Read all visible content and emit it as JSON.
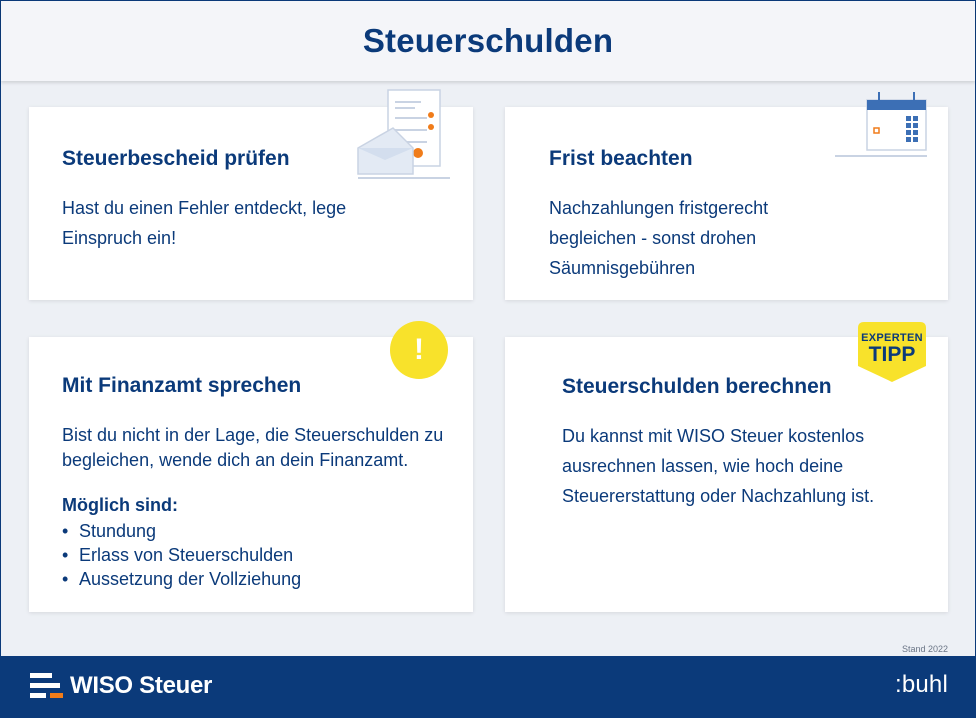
{
  "header": {
    "title": "Steuerschulden"
  },
  "cards": [
    {
      "title": "Steuerbescheid prüfen",
      "text": "Hast du einen Fehler entdeckt, lege Einspruch ein!",
      "icon": "document-envelope-icon"
    },
    {
      "title": "Frist beachten",
      "text": "Nachzahlungen fristgerecht begleichen - sonst drohen Säumnisgebühren",
      "icon": "calendar-icon"
    },
    {
      "title": "Mit Finanzamt sprechen",
      "text": "Bist du nicht in der Lage, die Steuerschulden zu begleichen, wende dich an dein Finanzamt.",
      "subheading": "Möglich sind:",
      "items": [
        "Stundung",
        "Erlass von Steuerschulden",
        "Aussetzung der Vollziehung"
      ],
      "icon": "exclamation-icon",
      "icon_symbol": "!"
    },
    {
      "title": "Steuerschulden berechnen",
      "text": "Du kannst mit WISO Steuer kostenlos ausrechnen lassen, wie hoch deine Steuererstattung oder Nachzahlung ist.",
      "badge": {
        "line1": "EXPERTEN",
        "line2": "TIPP"
      }
    }
  ],
  "stand": "Stand 2022",
  "footer": {
    "brand": "WISO Steuer",
    "company": ":buhl"
  },
  "colors": {
    "primary": "#0b3a7a",
    "accent_yellow": "#f8e22b",
    "accent_orange": "#f07c1a",
    "background": "#edf0f5"
  }
}
